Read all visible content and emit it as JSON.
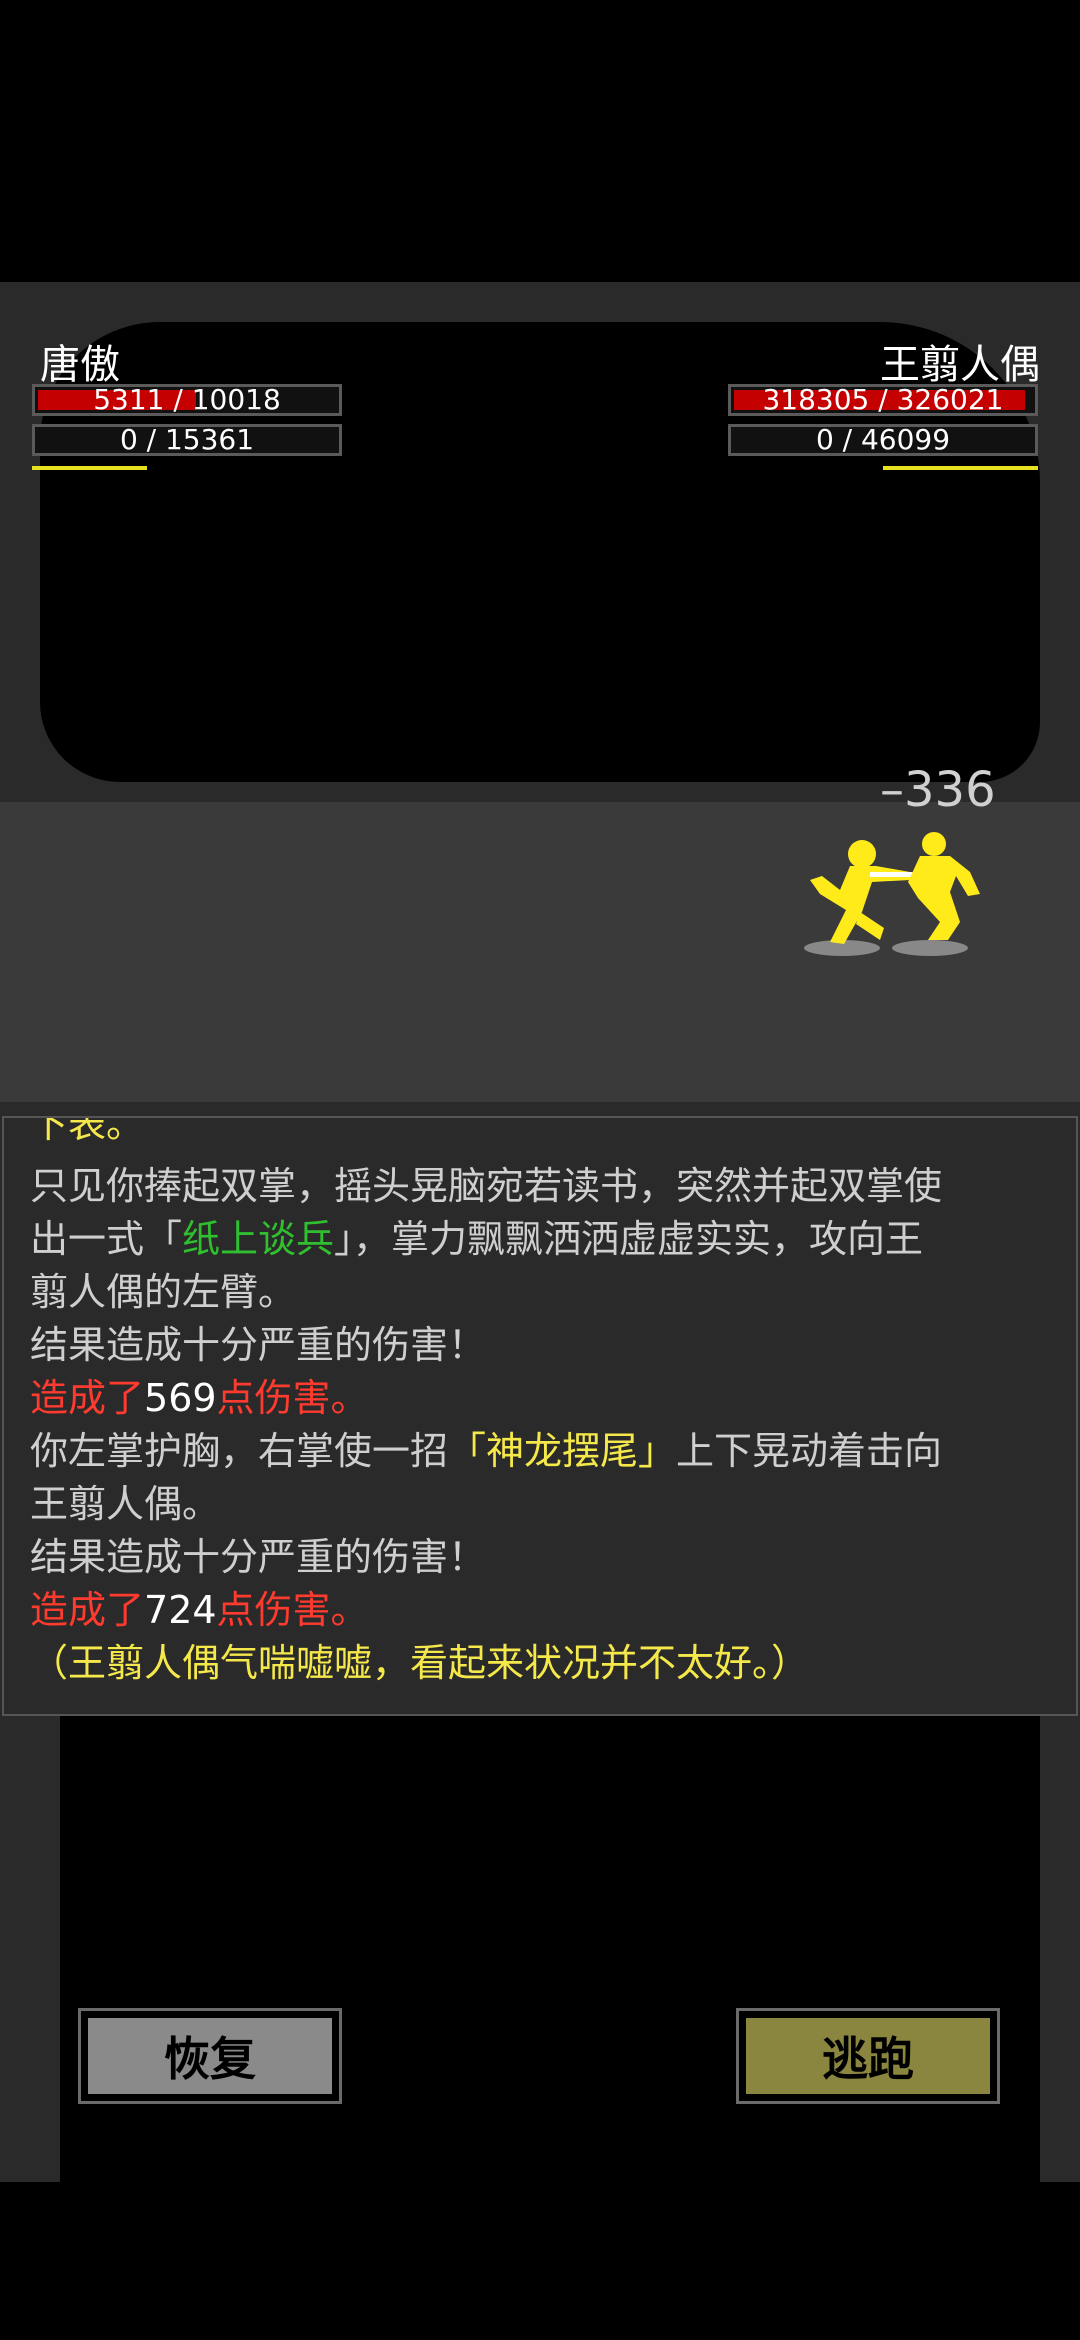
{
  "player": {
    "name": "唐傲",
    "hp_text": "5311 / 10018",
    "hp_fraction": 0.53,
    "mp_text": "0 / 15361",
    "stamina_fraction": 0.37
  },
  "enemy": {
    "name": "王翦人偶",
    "hp_text": "318305 / 326021",
    "hp_fraction": 0.976,
    "mp_text": "0 / 46099",
    "stamina_fraction": 0.5
  },
  "damage_popup": "–336",
  "log": {
    "partial_top": "下表。",
    "line1": "只见你捧起双掌，摇头晃脑宛若读书，突然并起双掌使",
    "line2_a": "出一式「",
    "line2_skill": "纸上谈兵",
    "line2_b": "」，掌力飘飘洒洒虚虚实实，攻向王",
    "line3": "翦人偶的左臂。",
    "line4": "结果造成十分严重的伤害！",
    "line5_a": "造成了",
    "line5_num": "569",
    "line5_b": "点伤害。",
    "line6_a": "你左掌护胸，右掌使一招",
    "line6_skill": "「神龙摆尾」",
    "line6_b": "上下晃动着击向",
    "line7": "王翦人偶。",
    "line8": "结果造成十分严重的伤害！",
    "line9_a": "造成了",
    "line9_num": "724",
    "line9_b": "点伤害。",
    "line10": "（王翦人偶气喘嘘嘘，看起来状况并不太好。）"
  },
  "buttons": {
    "recover": "恢复",
    "flee": "逃跑"
  },
  "colors": {
    "hp": "#c40000",
    "stamina": "#e6e020",
    "recover_btn": "#8a8a8a",
    "flee_btn": "#8a8640",
    "fighter": "#ffeb1a"
  }
}
